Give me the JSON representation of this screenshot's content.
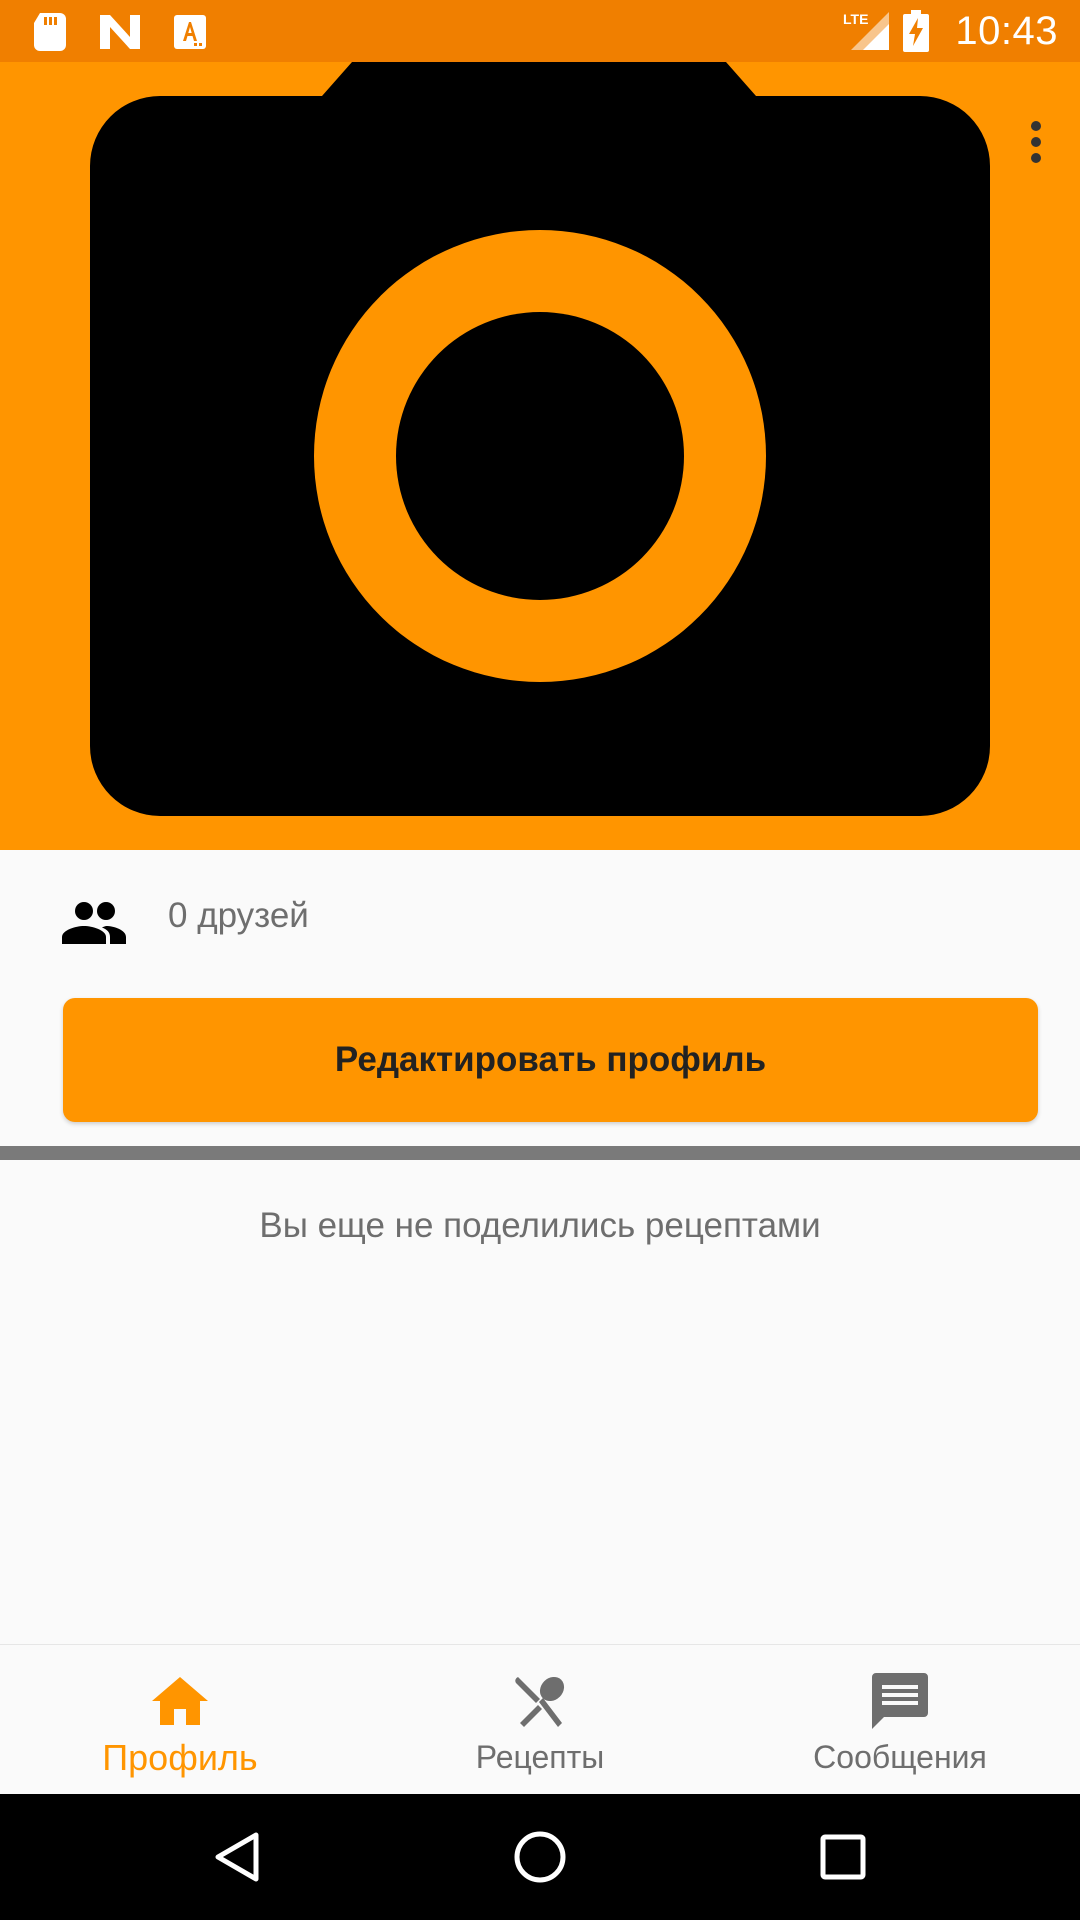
{
  "status_bar": {
    "time": "10:43",
    "network": "LTE",
    "icons": [
      "sd-card-icon",
      "n-logo-icon",
      "a-font-icon",
      "lte-signal-icon",
      "battery-charging-icon"
    ],
    "background": "#f07f00"
  },
  "header": {
    "placeholder_icon": "camera-icon",
    "background": "#ff9500",
    "menu_icon": "more-vert-icon"
  },
  "profile": {
    "friends_icon": "people-icon",
    "friends_text": "0 друзей",
    "edit_button_label": "Редактировать профиль",
    "empty_recipes_text": "Вы еще не поделились рецептами"
  },
  "bottom_nav": {
    "items": [
      {
        "label": "Профиль",
        "icon": "home-icon",
        "active": true
      },
      {
        "label": "Рецепты",
        "icon": "restaurant-icon",
        "active": false
      },
      {
        "label": "Сообщения",
        "icon": "message-icon",
        "active": false
      }
    ],
    "active_color": "#ff9500",
    "inactive_color": "#6e6e6e"
  },
  "system_nav": {
    "buttons": [
      "back-icon",
      "home-circle-icon",
      "recents-icon"
    ]
  }
}
